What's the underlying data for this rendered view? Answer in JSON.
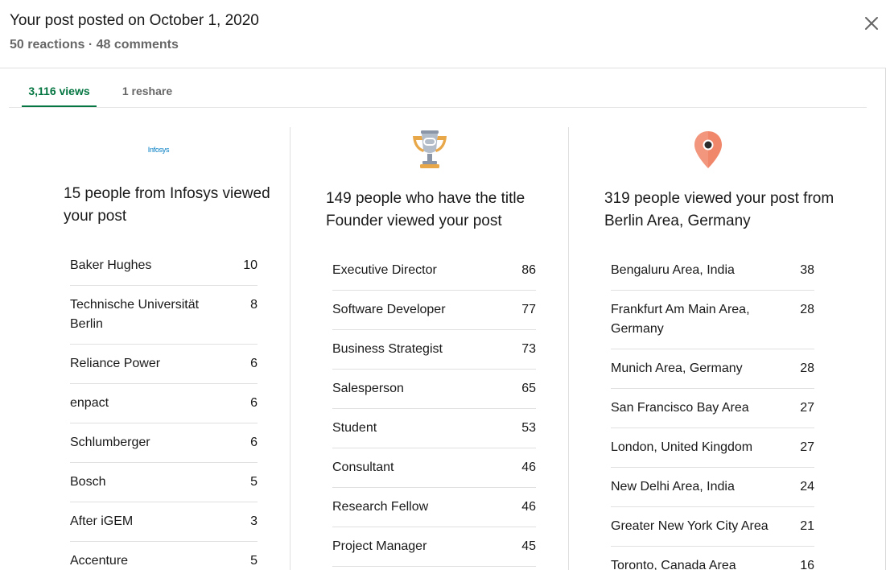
{
  "header": {
    "title": "Your post posted on October 1, 2020",
    "stats": "50 reactions · 48 comments"
  },
  "tabs": [
    {
      "label": "3,116 views",
      "active": true
    },
    {
      "label": "1 reshare",
      "active": false
    }
  ],
  "colors": {
    "accent": "#057642",
    "pin": "#f0876a",
    "trophy_top": "#a0abbb",
    "trophy_base": "#e8a84a"
  },
  "companies": {
    "icon": "infosys-logo",
    "logo_text": "Infosys",
    "heading": "15 people from Infosys viewed your post",
    "items": [
      {
        "name": "Baker Hughes",
        "count": "10"
      },
      {
        "name": "Technische Universität Berlin",
        "count": "8"
      },
      {
        "name": "Reliance Power",
        "count": "6"
      },
      {
        "name": "enpact",
        "count": "6"
      },
      {
        "name": "Schlumberger",
        "count": "6"
      },
      {
        "name": "Bosch",
        "count": "5"
      },
      {
        "name": "After iGEM",
        "count": "3"
      },
      {
        "name": "Accenture",
        "count": "5"
      }
    ]
  },
  "titles": {
    "icon": "trophy-icon",
    "heading": "149 people who have the title Founder viewed your post",
    "items": [
      {
        "name": "Executive Director",
        "count": "86"
      },
      {
        "name": "Software Developer",
        "count": "77"
      },
      {
        "name": "Business Strategist",
        "count": "73"
      },
      {
        "name": "Salesperson",
        "count": "65"
      },
      {
        "name": "Student",
        "count": "53"
      },
      {
        "name": "Consultant",
        "count": "46"
      },
      {
        "name": "Research Fellow",
        "count": "46"
      },
      {
        "name": "Project Manager",
        "count": "45"
      }
    ]
  },
  "locations": {
    "icon": "map-pin-icon",
    "heading": "319 people viewed your post from Berlin Area, Germany",
    "items": [
      {
        "name": "Bengaluru Area, India",
        "count": "38"
      },
      {
        "name": "Frankfurt Am Main Area, Germany",
        "count": "28"
      },
      {
        "name": "Munich Area, Germany",
        "count": "28"
      },
      {
        "name": "San Francisco Bay Area",
        "count": "27"
      },
      {
        "name": "London, United Kingdom",
        "count": "27"
      },
      {
        "name": "New Delhi Area, India",
        "count": "24"
      },
      {
        "name": "Greater New York City Area",
        "count": "21"
      },
      {
        "name": "Toronto, Canada Area",
        "count": "16"
      }
    ]
  }
}
